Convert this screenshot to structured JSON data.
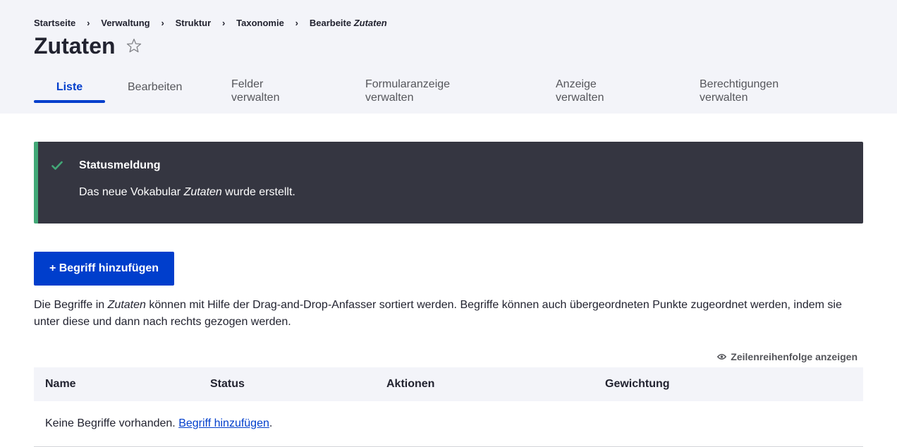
{
  "breadcrumb": {
    "items": [
      "Startseite",
      "Verwaltung",
      "Struktur",
      "Taxonomie"
    ],
    "current_prefix": "Bearbeite",
    "current_name": "Zutaten",
    "separator": "›"
  },
  "page": {
    "title": "Zutaten",
    "star_icon": "star-outline-icon"
  },
  "tabs": {
    "liste": "Liste",
    "bearbeiten": "Bearbeiten",
    "felder_l1": "Felder",
    "felder_l2": "verwalten",
    "formular_l1": "Formularanzeige",
    "formular_l2": "verwalten",
    "anzeige_l1": "Anzeige",
    "anzeige_l2": "verwalten",
    "berechtigungen_l1": "Berechtigungen",
    "berechtigungen_l2": "verwalten",
    "active": "Liste"
  },
  "status": {
    "title": "Statusmeldung",
    "text_before": "Das neue Vokabular",
    "text_em": "Zutaten",
    "text_after": "wurde erstellt.",
    "icon": "checkmark-icon"
  },
  "actions": {
    "add_term": "+ Begriff hinzufügen"
  },
  "description": {
    "before": "Die Begriffe in",
    "em": "Zutaten",
    "after": "können mit Hilfe der Drag-and-Drop-Anfasser sortiert werden. Begriffe können auch übergeordneten Punkte zugeordnet werden, indem sie unter diese und dann nach rechts gezogen werden."
  },
  "row_order": {
    "label": "Zeilenreihenfolge anzeigen",
    "icon": "eye-icon"
  },
  "table": {
    "columns": [
      "Name",
      "Status",
      "Aktionen",
      "Gewichtung"
    ],
    "empty_text": "Keine Begriffe vorhanden.",
    "empty_link": "Begriff hinzufügen",
    "empty_suffix": "."
  },
  "colors": {
    "accent": "#003ecc",
    "header_bg": "#f3f4f9",
    "status_bg": "#353641",
    "status_accent": "#42a877"
  }
}
